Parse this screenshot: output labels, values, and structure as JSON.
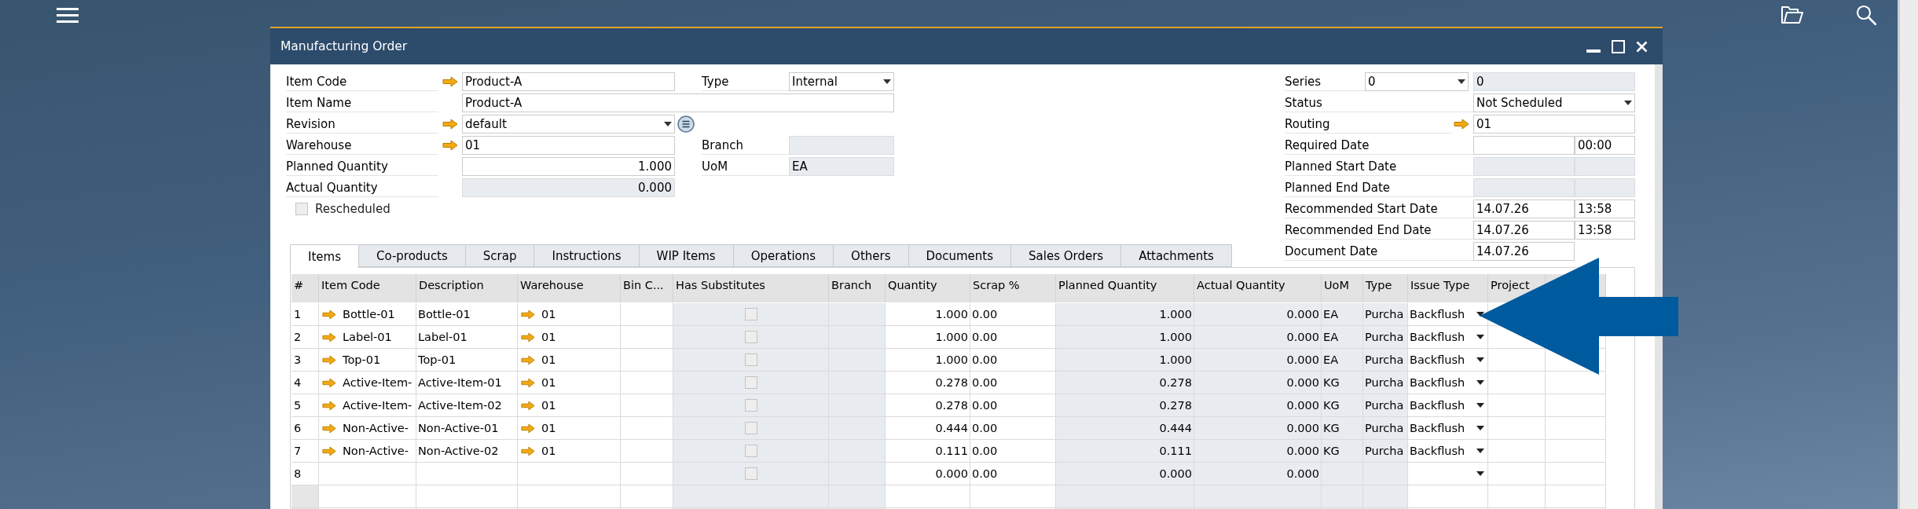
{
  "window": {
    "title": "Manufacturing Order"
  },
  "header": {
    "left": [
      {
        "label": "Item Code",
        "link": true,
        "list_button": false,
        "field": {
          "kind": "text",
          "value": "Product-A",
          "disabled": false
        },
        "side": {
          "label": "Type",
          "field": {
            "kind": "dropdown",
            "value": "Internal",
            "disabled": false
          }
        }
      },
      {
        "label": "Item Name",
        "link": false,
        "list_button": false,
        "field": {
          "kind": "wide",
          "value": "Product-A",
          "disabled": false
        }
      },
      {
        "label": "Revision",
        "link": true,
        "list_button": true,
        "field": {
          "kind": "dropdown",
          "value": "default",
          "disabled": false
        }
      },
      {
        "label": "Warehouse",
        "link": true,
        "list_button": false,
        "field": {
          "kind": "text",
          "value": "01",
          "disabled": false
        },
        "side": {
          "label": "Branch",
          "field": {
            "kind": "text",
            "disabled": true
          }
        }
      },
      {
        "label": "Planned Quantity",
        "link": false,
        "list_button": false,
        "field": {
          "kind": "number",
          "value": "1.000",
          "disabled": false
        },
        "side": {
          "label": "UoM",
          "field": {
            "kind": "text",
            "value": "EA",
            "disabled": true
          }
        }
      },
      {
        "label": "Actual Quantity",
        "link": false,
        "list_button": false,
        "field": {
          "kind": "number",
          "value": "0.000",
          "disabled": true
        }
      }
    ],
    "rescheduled": {
      "label": "Rescheduled",
      "checked": false
    },
    "right": [
      {
        "label": "Series",
        "link": false,
        "prefix": {
          "kind": "dropdown",
          "value": "0",
          "disabled": false
        },
        "fields": [
          {
            "kind": "text",
            "value": "0",
            "disabled": true
          }
        ]
      },
      {
        "label": "Status",
        "link": false,
        "fields": [
          {
            "kind": "dropdown",
            "value": "Not Scheduled",
            "disabled": false
          }
        ]
      },
      {
        "label": "Routing",
        "link": true,
        "fields": [
          {
            "kind": "text",
            "value": "01",
            "disabled": false
          }
        ]
      },
      {
        "label": "Required Date",
        "link": false,
        "fields": [
          {
            "kind": "date",
            "disabled": false
          },
          {
            "kind": "time",
            "value": "00:00",
            "disabled": false
          }
        ]
      },
      {
        "label": "Planned Start Date",
        "link": false,
        "fields": [
          {
            "kind": "date",
            "disabled": true
          },
          {
            "kind": "time",
            "disabled": true
          }
        ]
      },
      {
        "label": "Planned End Date",
        "link": false,
        "fields": [
          {
            "kind": "date",
            "disabled": true
          },
          {
            "kind": "time",
            "disabled": true
          }
        ]
      },
      {
        "label": "Recommended Start Date",
        "link": false,
        "fields": [
          {
            "kind": "date",
            "value": "14.07.26",
            "disabled": false
          },
          {
            "kind": "time",
            "value": "13:58",
            "disabled": false
          }
        ]
      },
      {
        "label": "Recommended End Date",
        "link": false,
        "fields": [
          {
            "kind": "date",
            "value": "14.07.26",
            "disabled": false
          },
          {
            "kind": "time",
            "value": "13:58",
            "disabled": false
          }
        ]
      },
      {
        "label": "Document Date",
        "link": false,
        "fields": [
          {
            "kind": "date",
            "value": "14.07.26",
            "disabled": false
          }
        ]
      }
    ]
  },
  "tabs": [
    {
      "label": "Items",
      "selected": true
    },
    {
      "label": "Co-products",
      "selected": false
    },
    {
      "label": "Scrap",
      "selected": false
    },
    {
      "label": "Instructions",
      "selected": false
    },
    {
      "label": "WIP Items",
      "selected": false
    },
    {
      "label": "Operations",
      "selected": false
    },
    {
      "label": "Others",
      "selected": false
    },
    {
      "label": "Documents",
      "selected": false
    },
    {
      "label": "Sales Orders",
      "selected": false
    },
    {
      "label": "Attachments",
      "selected": false
    }
  ],
  "table": {
    "columns": [
      {
        "label": "#",
        "kind": "index",
        "readonly": false
      },
      {
        "label": "Item Code",
        "kind": "link",
        "readonly": false
      },
      {
        "label": "Description",
        "kind": "text",
        "readonly": false
      },
      {
        "label": "Warehouse",
        "kind": "link",
        "readonly": false
      },
      {
        "label": "Bin C...",
        "kind": "text",
        "readonly": false
      },
      {
        "label": "Has Substitutes",
        "kind": "check",
        "readonly": true
      },
      {
        "label": "Branch",
        "kind": "text",
        "readonly": true
      },
      {
        "label": "Quantity",
        "kind": "number",
        "readonly": false
      },
      {
        "label": "Scrap %",
        "kind": "text",
        "readonly": false
      },
      {
        "label": "Planned Quantity",
        "kind": "number",
        "readonly": true
      },
      {
        "label": "Actual Quantity",
        "kind": "number",
        "readonly": true
      },
      {
        "label": "UoM",
        "kind": "text",
        "readonly": true
      },
      {
        "label": "Type",
        "kind": "text",
        "readonly": true
      },
      {
        "label": "Issue Type",
        "kind": "dropdown",
        "readonly": false
      },
      {
        "label": "Project",
        "kind": "text",
        "readonly": false
      },
      {
        "kind": "text",
        "readonly": false
      }
    ],
    "rows": [
      {
        "cells": [
          "1",
          "Bottle-01",
          "Bottle-01",
          "01",
          null,
          false,
          null,
          "1.000",
          "0.00",
          "1.000",
          "0.000",
          "EA",
          "Purcha",
          "Backflush",
          null,
          null
        ]
      },
      {
        "cells": [
          "2",
          "Label-01",
          "Label-01",
          "01",
          null,
          false,
          null,
          "1.000",
          "0.00",
          "1.000",
          "0.000",
          "EA",
          "Purcha",
          "Backflush",
          null,
          null
        ]
      },
      {
        "cells": [
          "3",
          "Top-01",
          "Top-01",
          "01",
          null,
          false,
          null,
          "1.000",
          "0.00",
          "1.000",
          "0.000",
          "EA",
          "Purcha",
          "Backflush",
          null,
          null
        ]
      },
      {
        "cells": [
          "4",
          "Active-Item-",
          "Active-Item-01",
          "01",
          null,
          false,
          null,
          "0.278",
          "0.00",
          "0.278",
          "0.000",
          "KG",
          "Purcha",
          "Backflush",
          null,
          null
        ]
      },
      {
        "cells": [
          "5",
          "Active-Item-",
          "Active-Item-02",
          "01",
          null,
          false,
          null,
          "0.278",
          "0.00",
          "0.278",
          "0.000",
          "KG",
          "Purcha",
          "Backflush",
          null,
          null
        ]
      },
      {
        "cells": [
          "6",
          "Non-Active-",
          "Non-Active-01",
          "01",
          null,
          false,
          null,
          "0.444",
          "0.00",
          "0.444",
          "0.000",
          "KG",
          "Purcha",
          "Backflush",
          null,
          null
        ]
      },
      {
        "cells": [
          "7",
          "Non-Active-",
          "Non-Active-02",
          "01",
          null,
          false,
          null,
          "0.111",
          "0.00",
          "0.111",
          "0.000",
          "KG",
          "Purcha",
          "Backflush",
          null,
          null
        ]
      },
      {
        "cells": [
          "8",
          null,
          null,
          null,
          null,
          false,
          null,
          "0.000",
          "0.00",
          "0.000",
          "0.000",
          null,
          null,
          null,
          null,
          null
        ]
      }
    ]
  }
}
